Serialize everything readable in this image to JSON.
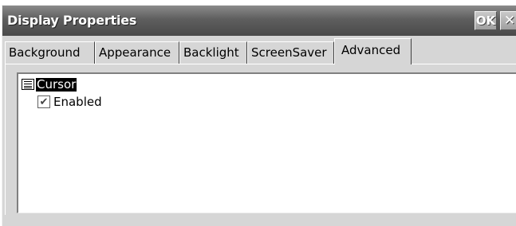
{
  "window": {
    "title": "Display Properties",
    "ok_label": "OK",
    "close_label": "✕"
  },
  "tabs": [
    {
      "label": "Background",
      "active": false
    },
    {
      "label": "Appearance",
      "active": false
    },
    {
      "label": "Backlight",
      "active": false
    },
    {
      "label": "ScreenSaver",
      "active": false
    },
    {
      "label": "Advanced",
      "active": true
    }
  ],
  "tree": {
    "node_label": "Cursor",
    "node_icon": "list-icon",
    "child": {
      "label": "Enabled",
      "checked": true,
      "check_glyph": "✔"
    }
  }
}
